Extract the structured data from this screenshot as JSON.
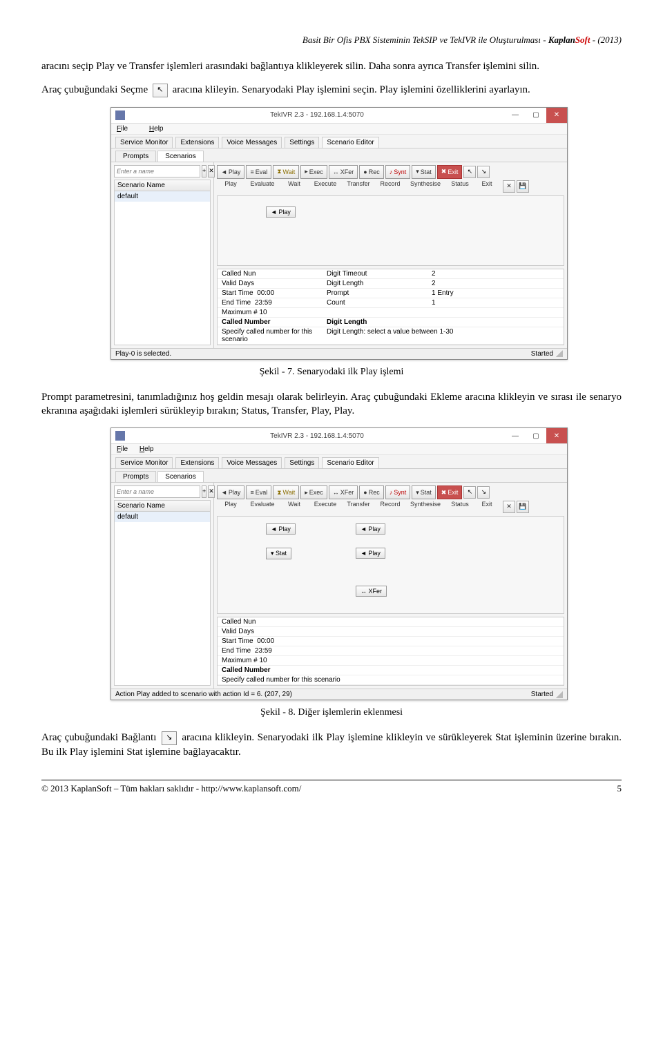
{
  "header": {
    "title": "Basit Bir Ofis PBX Sisteminin TekSIP ve TekIVR ile Oluşturulması - ",
    "brand_main": "Kaplan",
    "brand_soft": "Soft",
    "year": " - (2013)"
  },
  "para1": "aracını seçip Play ve Transfer işlemleri arasındaki bağlantıya klikleyerek silin. Daha sonra ayrıca Transfer işlemini silin.",
  "para2_a": "Araç çubuğundaki Seçme ",
  "para2_b": " aracına klileyin. Senaryodaki Play işlemini seçin. Play işlemini özelliklerini ayarlayın.",
  "caption1": "Şekil - 7. Senaryodaki ilk Play işlemi",
  "para3": "Prompt parametresini, tanımladığınız hoş geldin mesajı olarak belirleyin. Araç çubuğundaki Ekleme aracına klikleyin ve sırası ile senaryo ekranına aşağıdaki işlemleri sürükleyip bırakın; Status, Transfer, Play, Play.",
  "caption2": "Şekil - 8. Diğer işlemlerin eklenmesi",
  "para4_a": "Araç çubuğundaki Bağlantı ",
  "para4_b": " aracına klikleyin. Senaryodaki ilk Play işlemine klikleyin ve sürükleyerek Stat işleminin üzerine bırakın. Bu ilk Play işlemini Stat işlemine bağlayacaktır.",
  "footer": {
    "left": "© 2013 KaplanSoft – Tüm hakları saklıdır - http://www.kaplansoft.com/",
    "right": "5"
  },
  "win": {
    "title": "TekIVR 2.3 - 192.168.1.4:5070",
    "menu": {
      "file": "File",
      "help": "Help"
    },
    "maintabs": [
      "Service Monitor",
      "Extensions",
      "Voice Messages",
      "Settings",
      "Scenario Editor"
    ],
    "subtabs": [
      "Prompts",
      "Scenarios"
    ],
    "search_placeholder": "Enter a name",
    "list_header": "Scenario Name",
    "list_item": "default",
    "actions": [
      {
        "label": "Play",
        "sub": "Play"
      },
      {
        "label": "Eval",
        "sub": "Evaluate"
      },
      {
        "label": "Wait",
        "sub": "Wait"
      },
      {
        "label": "Exec",
        "sub": "Execute"
      },
      {
        "label": "XFer",
        "sub": "Transfer"
      },
      {
        "label": "Rec",
        "sub": "Record"
      },
      {
        "label": "Synt",
        "sub": "Synthesise"
      },
      {
        "label": "Stat",
        "sub": "Status"
      },
      {
        "label": "Exit",
        "sub": "Exit"
      }
    ],
    "canvas1": {
      "play": "Play"
    },
    "canvas2": {
      "play1": "Play",
      "play2": "Play",
      "stat": "Stat",
      "play3": "Play",
      "xfer": "XFer"
    },
    "props_left": [
      {
        "k": "Called Nun",
        "v": ""
      },
      {
        "k": "Valid Days",
        "v": ""
      },
      {
        "k": "Start Time",
        "v": "00:00"
      },
      {
        "k": "End Time",
        "v": "23:59"
      },
      {
        "k": "Maximum #",
        "v": "10"
      }
    ],
    "props_right": [
      {
        "k": "Digit Timeout",
        "v": "2"
      },
      {
        "k": "Digit Length",
        "v": "2"
      },
      {
        "k": "Prompt",
        "v": "1 Entry"
      },
      {
        "k": "Count",
        "v": "1"
      }
    ],
    "props_bold": {
      "k": "Called Number",
      "r": "Digit Length"
    },
    "props_desc1": "Specify called number for this scenario",
    "props_desc2": "Digit Length: select a value between 1-30",
    "status1": {
      "left": "Play-0 is selected.",
      "right": "Started"
    },
    "status2": {
      "left": "Action Play added to scenario with action Id = 6. (207, 29)",
      "right": "Started"
    }
  }
}
